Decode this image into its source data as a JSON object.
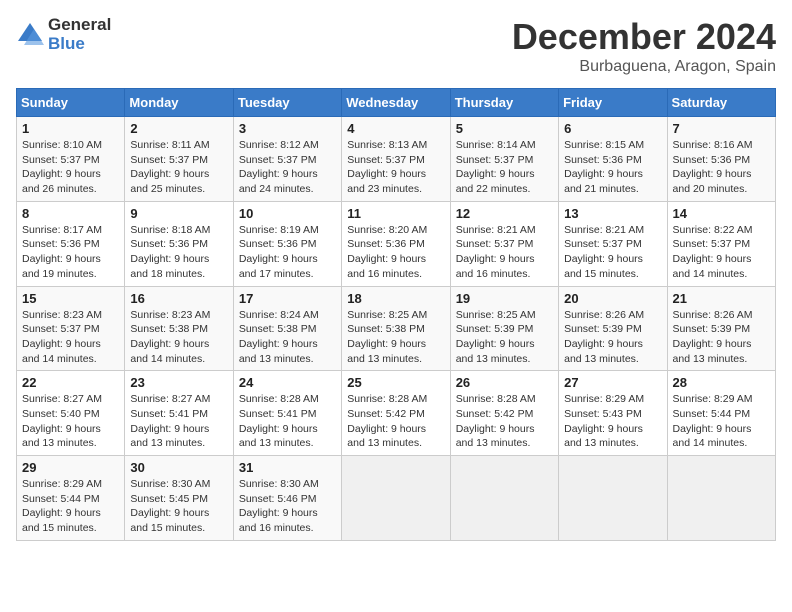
{
  "logo": {
    "general": "General",
    "blue": "Blue"
  },
  "header": {
    "month": "December 2024",
    "location": "Burbaguena, Aragon, Spain"
  },
  "weekdays": [
    "Sunday",
    "Monday",
    "Tuesday",
    "Wednesday",
    "Thursday",
    "Friday",
    "Saturday"
  ],
  "weeks": [
    [
      {
        "day": "1",
        "sunrise": "8:10 AM",
        "sunset": "5:37 PM",
        "daylight": "9 hours and 26 minutes."
      },
      {
        "day": "2",
        "sunrise": "8:11 AM",
        "sunset": "5:37 PM",
        "daylight": "9 hours and 25 minutes."
      },
      {
        "day": "3",
        "sunrise": "8:12 AM",
        "sunset": "5:37 PM",
        "daylight": "9 hours and 24 minutes."
      },
      {
        "day": "4",
        "sunrise": "8:13 AM",
        "sunset": "5:37 PM",
        "daylight": "9 hours and 23 minutes."
      },
      {
        "day": "5",
        "sunrise": "8:14 AM",
        "sunset": "5:37 PM",
        "daylight": "9 hours and 22 minutes."
      },
      {
        "day": "6",
        "sunrise": "8:15 AM",
        "sunset": "5:36 PM",
        "daylight": "9 hours and 21 minutes."
      },
      {
        "day": "7",
        "sunrise": "8:16 AM",
        "sunset": "5:36 PM",
        "daylight": "9 hours and 20 minutes."
      }
    ],
    [
      {
        "day": "8",
        "sunrise": "8:17 AM",
        "sunset": "5:36 PM",
        "daylight": "9 hours and 19 minutes."
      },
      {
        "day": "9",
        "sunrise": "8:18 AM",
        "sunset": "5:36 PM",
        "daylight": "9 hours and 18 minutes."
      },
      {
        "day": "10",
        "sunrise": "8:19 AM",
        "sunset": "5:36 PM",
        "daylight": "9 hours and 17 minutes."
      },
      {
        "day": "11",
        "sunrise": "8:20 AM",
        "sunset": "5:36 PM",
        "daylight": "9 hours and 16 minutes."
      },
      {
        "day": "12",
        "sunrise": "8:21 AM",
        "sunset": "5:37 PM",
        "daylight": "9 hours and 16 minutes."
      },
      {
        "day": "13",
        "sunrise": "8:21 AM",
        "sunset": "5:37 PM",
        "daylight": "9 hours and 15 minutes."
      },
      {
        "day": "14",
        "sunrise": "8:22 AM",
        "sunset": "5:37 PM",
        "daylight": "9 hours and 14 minutes."
      }
    ],
    [
      {
        "day": "15",
        "sunrise": "8:23 AM",
        "sunset": "5:37 PM",
        "daylight": "9 hours and 14 minutes."
      },
      {
        "day": "16",
        "sunrise": "8:23 AM",
        "sunset": "5:38 PM",
        "daylight": "9 hours and 14 minutes."
      },
      {
        "day": "17",
        "sunrise": "8:24 AM",
        "sunset": "5:38 PM",
        "daylight": "9 hours and 13 minutes."
      },
      {
        "day": "18",
        "sunrise": "8:25 AM",
        "sunset": "5:38 PM",
        "daylight": "9 hours and 13 minutes."
      },
      {
        "day": "19",
        "sunrise": "8:25 AM",
        "sunset": "5:39 PM",
        "daylight": "9 hours and 13 minutes."
      },
      {
        "day": "20",
        "sunrise": "8:26 AM",
        "sunset": "5:39 PM",
        "daylight": "9 hours and 13 minutes."
      },
      {
        "day": "21",
        "sunrise": "8:26 AM",
        "sunset": "5:39 PM",
        "daylight": "9 hours and 13 minutes."
      }
    ],
    [
      {
        "day": "22",
        "sunrise": "8:27 AM",
        "sunset": "5:40 PM",
        "daylight": "9 hours and 13 minutes."
      },
      {
        "day": "23",
        "sunrise": "8:27 AM",
        "sunset": "5:41 PM",
        "daylight": "9 hours and 13 minutes."
      },
      {
        "day": "24",
        "sunrise": "8:28 AM",
        "sunset": "5:41 PM",
        "daylight": "9 hours and 13 minutes."
      },
      {
        "day": "25",
        "sunrise": "8:28 AM",
        "sunset": "5:42 PM",
        "daylight": "9 hours and 13 minutes."
      },
      {
        "day": "26",
        "sunrise": "8:28 AM",
        "sunset": "5:42 PM",
        "daylight": "9 hours and 13 minutes."
      },
      {
        "day": "27",
        "sunrise": "8:29 AM",
        "sunset": "5:43 PM",
        "daylight": "9 hours and 13 minutes."
      },
      {
        "day": "28",
        "sunrise": "8:29 AM",
        "sunset": "5:44 PM",
        "daylight": "9 hours and 14 minutes."
      }
    ],
    [
      {
        "day": "29",
        "sunrise": "8:29 AM",
        "sunset": "5:44 PM",
        "daylight": "9 hours and 15 minutes."
      },
      {
        "day": "30",
        "sunrise": "8:30 AM",
        "sunset": "5:45 PM",
        "daylight": "9 hours and 15 minutes."
      },
      {
        "day": "31",
        "sunrise": "8:30 AM",
        "sunset": "5:46 PM",
        "daylight": "9 hours and 16 minutes."
      },
      null,
      null,
      null,
      null
    ]
  ]
}
